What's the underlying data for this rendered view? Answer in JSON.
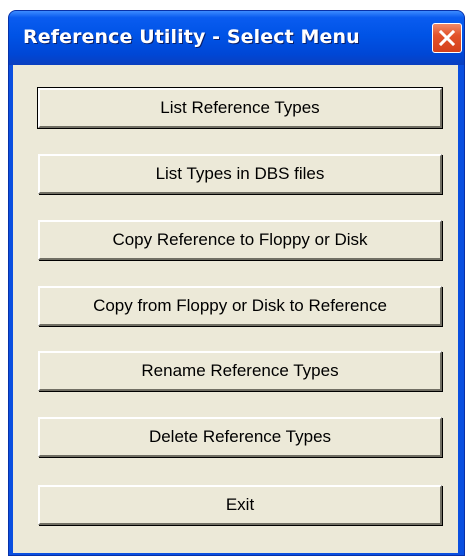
{
  "window": {
    "title": "Reference Utility - Select Menu",
    "close_icon": "close-icon"
  },
  "menu": {
    "buttons": [
      {
        "label": "List Reference Types"
      },
      {
        "label": "List Types in DBS files"
      },
      {
        "label": "Copy Reference to Floppy or Disk"
      },
      {
        "label": "Copy from Floppy or Disk to Reference"
      },
      {
        "label": "Rename Reference Types"
      },
      {
        "label": "Delete Reference Types"
      },
      {
        "label": "Exit"
      }
    ]
  },
  "colors": {
    "titlebar": "#0053e6",
    "client_background": "#ece9d8",
    "close_button": "#d4401c"
  }
}
